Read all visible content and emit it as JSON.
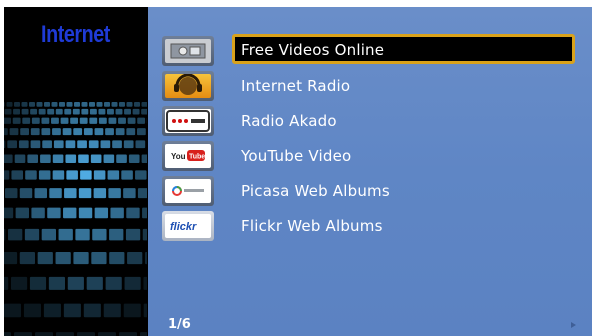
{
  "header": {
    "section_title": "Internet"
  },
  "menu": {
    "selected_index": 0,
    "items": [
      {
        "label": "Free Videos Online",
        "icon": "free-videos-icon"
      },
      {
        "label": "Internet Radio",
        "icon": "internet-radio-icon"
      },
      {
        "label": "Radio Akado",
        "icon": "radio-akado-icon"
      },
      {
        "label": "YouTube Video",
        "icon": "youtube-icon"
      },
      {
        "label": "Picasa Web Albums",
        "icon": "picasa-icon"
      },
      {
        "label": "Flickr Web Albums",
        "icon": "flickr-icon"
      }
    ]
  },
  "footer": {
    "page_indicator": "1/6"
  },
  "colors": {
    "title": "#1f3bd6",
    "panel_bg": "#6086c5",
    "highlight_border": "#d9a21b"
  }
}
